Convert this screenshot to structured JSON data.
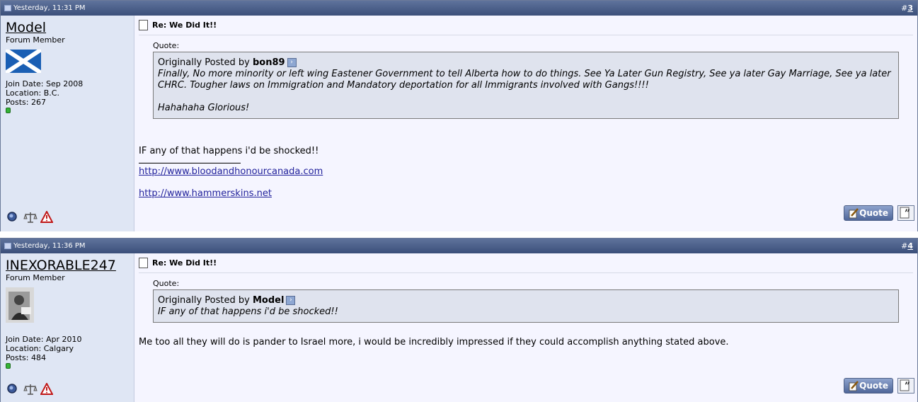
{
  "posts": [
    {
      "date": "Yesterday, 11:31 PM",
      "number_prefix": "#",
      "number": "3",
      "user": {
        "name": "Model",
        "title": "Forum Member",
        "join_date": "Join Date: Sep 2008",
        "location": "Location: B.C.",
        "posts": "Posts: 267",
        "avatar_icon": "scotland-flag-avatar"
      },
      "title": "Re: We Did It!!",
      "quote_label": "Quote:",
      "quote_by_prefix": "Originally Posted by ",
      "quote_author": "bon89",
      "quote_lines": [
        "Finally, No more minority or left wing Eastener Government to tell Alberta how to do things. See Ya Later Gun Registry, See ya later Gay Marriage, See ya later CHRC. Tougher laws on Immigration and Mandatory deportation for all Immigrants involved with Gangs!!!!",
        "Hahahaha Glorious!"
      ],
      "body": "IF any of that happens i'd be shocked!!",
      "signature_links": [
        "http://www.bloodandhonourcanada.com",
        "http://www.hammerskins.net"
      ],
      "quote_button": "Quote"
    },
    {
      "date": "Yesterday, 11:36 PM",
      "number_prefix": "#",
      "number": "4",
      "user": {
        "name": "INEXORABLE247",
        "title": "Forum Member",
        "join_date": "Join Date: Apr 2010",
        "location": "Location: Calgary",
        "posts": "Posts: 484",
        "avatar_icon": "photo-avatar"
      },
      "title": "Re: We Did It!!",
      "quote_label": "Quote:",
      "quote_by_prefix": "Originally Posted by ",
      "quote_author": "Model",
      "quote_lines": [
        "IF any of that happens i'd be shocked!!"
      ],
      "body": "Me too all they will do is pander to Israel more, i would be incredibly impressed if they could accomplish anything stated above.",
      "quote_button": "Quote"
    }
  ],
  "colors": {
    "header": "#4a5f8a",
    "userinfo_bg": "#dfe6f4",
    "message_bg": "#f5f5ff",
    "quote_bg": "#dfe3ee",
    "link": "#22229c"
  }
}
